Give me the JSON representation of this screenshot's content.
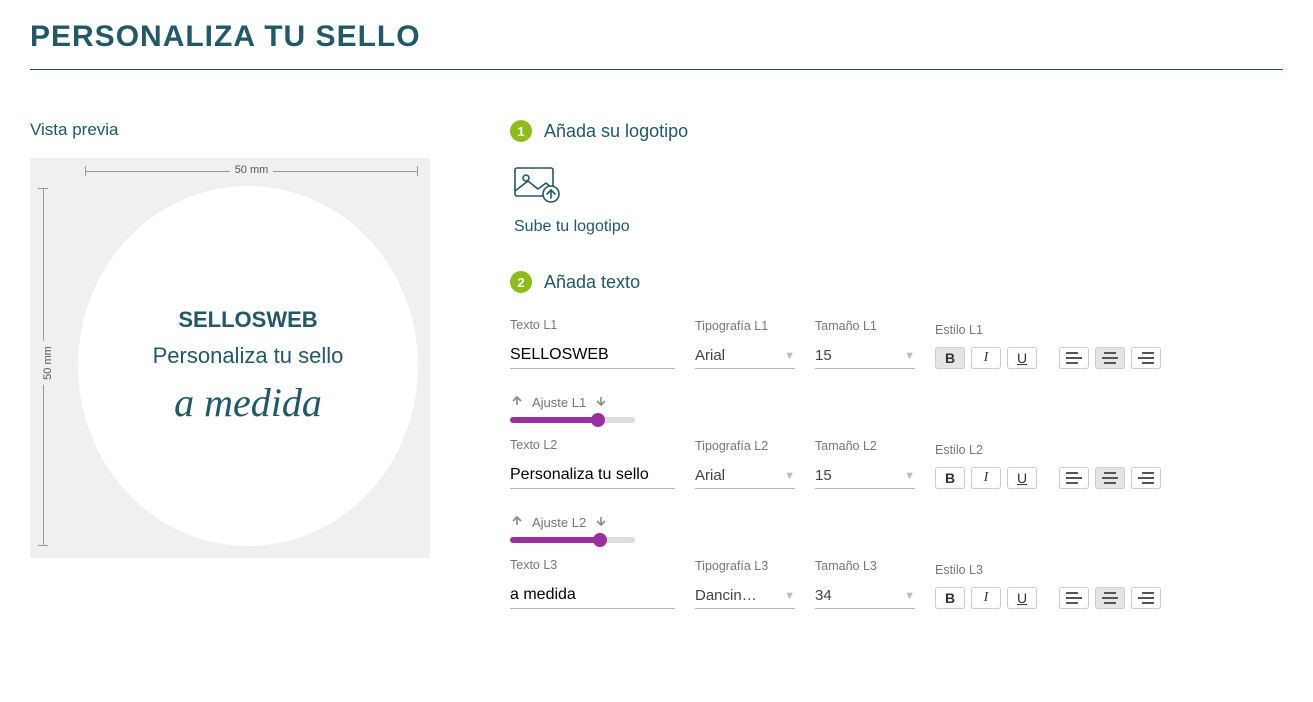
{
  "title": "PERSONALIZA TU SELLO",
  "preview": {
    "label": "Vista previa",
    "width_label": "50 mm",
    "height_label": "50 mm",
    "line1": "SELLOSWEB",
    "line2": "Personaliza tu sello",
    "line3": "a medida"
  },
  "step1": {
    "num": "1",
    "label": "Añada su logotipo",
    "upload_text": "Sube tu logotipo"
  },
  "step2": {
    "num": "2",
    "label": "Añada texto"
  },
  "lines": [
    {
      "text_label": "Texto L1",
      "text_value": "SELLOSWEB",
      "font_label": "Tipografía L1",
      "font_value": "Arial",
      "size_label": "Tamaño L1",
      "size_value": "15",
      "style_label": "Estilo L1",
      "adjust_label": "Ajuste L1",
      "bold_active": true,
      "align": "center",
      "slider_pct": 70
    },
    {
      "text_label": "Texto L2",
      "text_value": "Personaliza tu sello",
      "font_label": "Tipografía L2",
      "font_value": "Arial",
      "size_label": "Tamaño L2",
      "size_value": "15",
      "style_label": "Estilo L2",
      "adjust_label": "Ajuste L2",
      "bold_active": false,
      "align": "center",
      "slider_pct": 72
    },
    {
      "text_label": "Texto L3",
      "text_value": "a medida",
      "font_label": "Tipografía L3",
      "font_value": "Dancin…",
      "size_label": "Tamaño L3",
      "size_value": "34",
      "style_label": "Estilo L3",
      "adjust_label": "",
      "bold_active": false,
      "align": "center",
      "slider_pct": 0
    }
  ]
}
